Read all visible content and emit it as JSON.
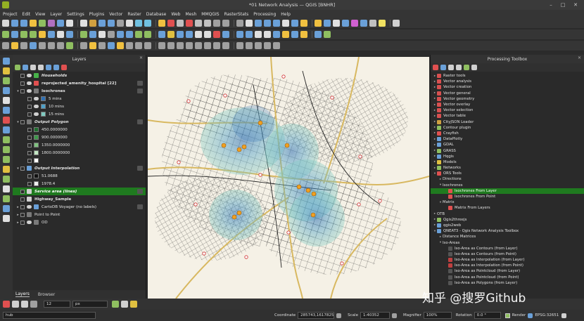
{
  "window": {
    "title": "*01 Network Analysis — QGIS [BNHR]"
  },
  "menu": [
    "Project",
    "Edit",
    "View",
    "Layer",
    "Settings",
    "Plugins",
    "Vector",
    "Raster",
    "Database",
    "Web",
    "Mesh",
    "MMQGIS",
    "RasterStats",
    "Processing",
    "Help"
  ],
  "icons": {
    "toolbar1": [
      "#d8d8d8",
      "#6aa0d8",
      "#6aa0d8",
      "#f0c040",
      "#8fbf60",
      "#b070c0",
      "#6aa0d8",
      "#e0e0e0",
      "#e0e0e0",
      "#d0a040",
      "#6aa0d8",
      "#6aa0d8",
      "#a0a0a0",
      "#e0e0e0",
      "#70c0e0",
      "#70c0e0",
      "#f0c040",
      "#e05050",
      "#c0c0c0",
      "#e05050",
      "#c0c0c0",
      "#c0c0c0",
      "#a0a0a0",
      "#a0a0a0",
      "#a0a0a0",
      "#e0e0e0",
      "#6aa0d8",
      "#6aa0d8",
      "#6aa0d8",
      "#e0e0e0",
      "#6aa0d8",
      "#f0c040",
      "#f0c040",
      "#6aa0d8",
      "#e0e0e0",
      "#6aa0d8",
      "#d060d0",
      "#6aa0d8",
      "#c0c0c0",
      "#f0e060",
      "#d0d0d0"
    ],
    "toolbar2": [
      "#8fbf60",
      "#6aa0d8",
      "#8fbf60",
      "#8fbf60",
      "#f0c040",
      "#6aa0d8",
      "#e0e0e0",
      "#6aa0d8",
      "#8fbf60",
      "#6aa0d8",
      "#e0e0e0",
      "#a0a0a0",
      "#6aa0d8",
      "#6aa0d8",
      "#8fbf60",
      "#8fbf60",
      "#6aa0d8",
      "#e0c040",
      "#6aa0d8",
      "#6aa0d8",
      "#e0e0e0",
      "#e0e0e0",
      "#e05050",
      "#6aa0d8",
      "#6aa0d8",
      "#6aa0d8",
      "#e0e0e0",
      "#e0e0e0",
      "#6aa0d8",
      "#f0c040",
      "#6aa0d8",
      "#f0c040",
      "#6aa0d8",
      "#8fbf60"
    ],
    "toolbar3": [
      "#a0a0a0",
      "#f0c040",
      "#a0a0a0",
      "#6aa0d8",
      "#a0a0a0",
      "#a0a0a0",
      "#a0a0a0",
      "#8fbf60",
      "#a0a0a0",
      "#f0c040",
      "#a0a0a0",
      "#6aa0d8",
      "#f0c040",
      "#a0a0a0",
      "#a0a0a0",
      "#a0a0a0",
      "#a0a0a0",
      "#a0a0a0",
      "#a0a0a0",
      "#a0a0a0",
      "#a0a0a0",
      "#a0a0a0",
      "#a0a0a0",
      "#a0a0a0",
      "#a0a0a0",
      "#a0a0a0",
      "#a0a0a0",
      "#a0a0a0",
      "#a0a0a0"
    ],
    "vtool": [
      "#6aa0d8",
      "#e0c040",
      "#8fbf60",
      "#6aa0d8",
      "#e0e0e0",
      "#6aa0d8",
      "#e05050",
      "#6aa0d8",
      "#8fbf60",
      "#8fbf60",
      "#8fbf60",
      "#e0c040",
      "#8fbf60",
      "#e0e0e0",
      "#8fbf60",
      "#6aa0d8",
      "#e0e0e0"
    ]
  },
  "layers_panel": {
    "title": "Layers",
    "tabs": [
      "Layers",
      "Browser"
    ],
    "rows": [
      {
        "label": "Households",
        "indent": 0,
        "arrow": "",
        "eye": true,
        "icon": "#47b24a",
        "style": "italic"
      },
      {
        "label": "reprojected_amenity_hospital [22]",
        "indent": 0,
        "arrow": "",
        "eye": true,
        "icon": "#e05050",
        "style": "bold",
        "badge": true
      },
      {
        "label": "Isochrones",
        "indent": 0,
        "arrow": "▾",
        "eye": true,
        "icon": "#7a7a7a",
        "style": "bold",
        "badge": true
      },
      {
        "label": "5 mins",
        "indent": 1,
        "arrow": "",
        "eye": true,
        "swatch": "#2f6fb2"
      },
      {
        "label": "10 mins",
        "indent": 1,
        "arrow": "",
        "eye": true,
        "swatch": "#4ea0c8"
      },
      {
        "label": "15 mins",
        "indent": 1,
        "arrow": "",
        "eye": true,
        "swatch": "#7ecac0"
      },
      {
        "label": "Output Polygon",
        "indent": 0,
        "arrow": "▾",
        "eye": false,
        "icon": "#7a7a7a",
        "style": "italic",
        "badge": true
      },
      {
        "label": "450.0000000",
        "indent": 1,
        "arrow": "",
        "eye": false,
        "swatch": "#1e6e2e"
      },
      {
        "label": "900.0000000",
        "indent": 1,
        "arrow": "",
        "eye": false,
        "swatch": "#3d9a4a"
      },
      {
        "label": "1350.0000000",
        "indent": 1,
        "arrow": "",
        "eye": false,
        "swatch": "#7fc27f"
      },
      {
        "label": "1800.0000000",
        "indent": 1,
        "arrow": "",
        "eye": false,
        "swatch": "#c2e6c2"
      },
      {
        "label": "",
        "indent": 1,
        "arrow": "",
        "eye": false,
        "swatch": "#ffffff"
      },
      {
        "label": "Output Interpolation",
        "indent": 0,
        "arrow": "▾",
        "eye": false,
        "icon": "#6aa0d8",
        "style": "italic",
        "badge": true
      },
      {
        "label": "51.0688",
        "indent": 1,
        "arrow": "",
        "eye": false,
        "swatch": "#111111"
      },
      {
        "label": "1978.4",
        "indent": 1,
        "arrow": "",
        "eye": false,
        "swatch": "#f0f0f0"
      },
      {
        "label": "Service area (lines)",
        "indent": 0,
        "arrow": "",
        "eye": false,
        "icon": "#d0d0d0",
        "style": "italic",
        "selected": true,
        "badge": true
      },
      {
        "label": "Highway_Sample",
        "indent": 0,
        "arrow": "",
        "eye": false,
        "icon": "#d0d0d0",
        "style": "bold"
      },
      {
        "label": "CartoDB Voyager (no labels)",
        "indent": 0,
        "arrow": "▸",
        "eye": true,
        "icon": "#6aa0d8",
        "style": "normal",
        "badge": true
      },
      {
        "label": "Point to Point",
        "indent": 0,
        "arrow": "▸",
        "eye": false,
        "icon": "#7a7a7a",
        "style": "normal"
      },
      {
        "label": "OD",
        "indent": 0,
        "arrow": "▸",
        "eye": true,
        "icon": "#7a7a7a",
        "style": "normal"
      }
    ]
  },
  "processing": {
    "title": "Processing Toolbox",
    "tree": [
      {
        "label": "Raster tools",
        "level": 0,
        "arrow": "▸",
        "icon": "#d85050"
      },
      {
        "label": "Vector analysis",
        "level": 0,
        "arrow": "▸",
        "icon": "#d85050"
      },
      {
        "label": "Vector creation",
        "level": 0,
        "arrow": "▸",
        "icon": "#d85050"
      },
      {
        "label": "Vector general",
        "level": 0,
        "arrow": "▸",
        "icon": "#d85050"
      },
      {
        "label": "Vector geometry",
        "level": 0,
        "arrow": "▸",
        "icon": "#d85050"
      },
      {
        "label": "Vector overlay",
        "level": 0,
        "arrow": "▸",
        "icon": "#d85050"
      },
      {
        "label": "Vector selection",
        "level": 0,
        "arrow": "▸",
        "icon": "#d85050"
      },
      {
        "label": "Vector table",
        "level": 0,
        "arrow": "▸",
        "icon": "#d85050"
      },
      {
        "label": "CityJSON Loader",
        "level": 0,
        "arrow": "▸",
        "icon": "#d0a040"
      },
      {
        "label": "Contour plugin",
        "level": 0,
        "arrow": "▸",
        "icon": "#8fbf60"
      },
      {
        "label": "Crayfish",
        "level": 0,
        "arrow": "▸",
        "icon": "#e05050"
      },
      {
        "label": "DataPlotly",
        "level": 0,
        "arrow": "▸",
        "icon": "#6aa0d8"
      },
      {
        "label": "GDAL",
        "level": 0,
        "arrow": "▸",
        "icon": "#6aa0d8"
      },
      {
        "label": "GRASS",
        "level": 0,
        "arrow": "▸",
        "icon": "#8fbf60"
      },
      {
        "label": "Hqgis",
        "level": 0,
        "arrow": "▸",
        "icon": "#6aa0d8"
      },
      {
        "label": "Models",
        "level": 0,
        "arrow": "▸",
        "icon": "#e0c040"
      },
      {
        "label": "Networks",
        "level": 0,
        "arrow": "▸",
        "icon": "#8fbf60"
      },
      {
        "label": "ORS Tools",
        "level": 0,
        "arrow": "▾",
        "icon": "#e05050"
      },
      {
        "label": "Directions",
        "level": 1,
        "arrow": "▸",
        "icon": ""
      },
      {
        "label": "Isochrones",
        "level": 1,
        "arrow": "▾",
        "icon": ""
      },
      {
        "label": "Isochrones From Layer",
        "level": 2,
        "arrow": "",
        "icon": "#e05050",
        "selected": true
      },
      {
        "label": "Isochrones From Point",
        "level": 2,
        "arrow": "",
        "icon": "#e05050"
      },
      {
        "label": "Matrix",
        "level": 1,
        "arrow": "▾",
        "icon": ""
      },
      {
        "label": "Matrix From Layers",
        "level": 2,
        "arrow": "",
        "icon": "#e05050"
      },
      {
        "label": "OTB",
        "level": 0,
        "arrow": "▸",
        "icon": ""
      },
      {
        "label": "Qgis2threejs",
        "level": 0,
        "arrow": "▸",
        "icon": "#8fbf60"
      },
      {
        "label": "qgis2web",
        "level": 0,
        "arrow": "▸",
        "icon": "#6aa0d8"
      },
      {
        "label": "QNEAT3 - Qgis Network Analysis Toolbox",
        "level": 0,
        "arrow": "▾",
        "icon": "#6aa0d8"
      },
      {
        "label": "Distance Matrices",
        "level": 1,
        "arrow": "▸",
        "icon": ""
      },
      {
        "label": "Iso-Areas",
        "level": 1,
        "arrow": "▾",
        "icon": ""
      },
      {
        "label": "Iso-Area as Contours (from Layer)",
        "level": 2,
        "arrow": "",
        "icon": "#555555"
      },
      {
        "label": "Iso-Area as Contours (from Point)",
        "level": 2,
        "arrow": "",
        "icon": "#555555"
      },
      {
        "label": "Iso-Area as Interpolation (from Layer)",
        "level": 2,
        "arrow": "",
        "icon": "#c04040"
      },
      {
        "label": "Iso-Area as Interpolation (from Point)",
        "level": 2,
        "arrow": "",
        "icon": "#c04040"
      },
      {
        "label": "Iso-Area as Pointcloud (from Layer)",
        "level": 2,
        "arrow": "",
        "icon": "#555555"
      },
      {
        "label": "Iso-Area as Pointcloud (from Point)",
        "level": 2,
        "arrow": "",
        "icon": "#555555"
      },
      {
        "label": "Iso-Area as Polygons (from Layer)",
        "level": 2,
        "arrow": "",
        "icon": "#555555"
      }
    ]
  },
  "snapping": {
    "size_value": "12",
    "size_unit": "px"
  },
  "status": {
    "search_value": "hub",
    "coordinate_label": "Coordinate",
    "coordinate_value": "285743,1617825",
    "scale_label": "Scale",
    "scale_value": "1:40352",
    "magnifier_label": "Magnifier",
    "magnifier_value": "100%",
    "rotation_label": "Rotation",
    "rotation_value": "0.0 °",
    "render_label": "Render",
    "crs_label": "EPSG:32651"
  },
  "watermark": "知乎 @搜罗Github"
}
